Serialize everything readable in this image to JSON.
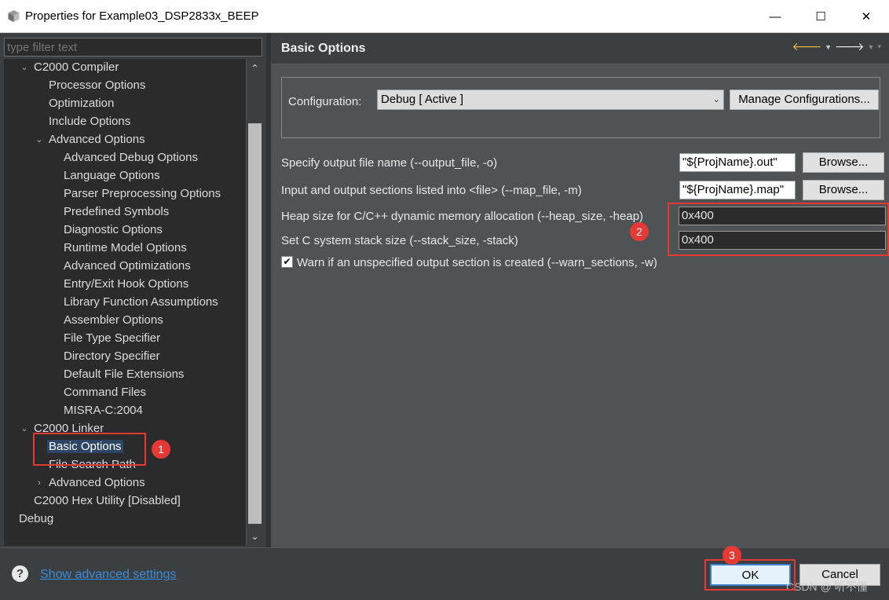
{
  "window": {
    "title": "Properties for Example03_DSP2833x_BEEP",
    "minimize_glyph": "—",
    "maximize_glyph": "☐",
    "close_glyph": "✕"
  },
  "left": {
    "filter_placeholder": "type filter text",
    "tree": [
      {
        "label": "C2000 Compiler",
        "indent": 1,
        "twisty": "⌄"
      },
      {
        "label": "Processor Options",
        "indent": 2
      },
      {
        "label": "Optimization",
        "indent": 2
      },
      {
        "label": "Include Options",
        "indent": 2
      },
      {
        "label": "Advanced Options",
        "indent": 2,
        "twisty": "⌄"
      },
      {
        "label": "Advanced Debug Options",
        "indent": 3
      },
      {
        "label": "Language Options",
        "indent": 3
      },
      {
        "label": "Parser Preprocessing Options",
        "indent": 3
      },
      {
        "label": "Predefined Symbols",
        "indent": 3
      },
      {
        "label": "Diagnostic Options",
        "indent": 3
      },
      {
        "label": "Runtime Model Options",
        "indent": 3
      },
      {
        "label": "Advanced Optimizations",
        "indent": 3
      },
      {
        "label": "Entry/Exit Hook Options",
        "indent": 3
      },
      {
        "label": "Library Function Assumptions",
        "indent": 3
      },
      {
        "label": "Assembler Options",
        "indent": 3
      },
      {
        "label": "File Type Specifier",
        "indent": 3
      },
      {
        "label": "Directory Specifier",
        "indent": 3
      },
      {
        "label": "Default File Extensions",
        "indent": 3
      },
      {
        "label": "Command Files",
        "indent": 3
      },
      {
        "label": "MISRA-C:2004",
        "indent": 3
      },
      {
        "label": "C2000 Linker",
        "indent": 1,
        "twisty": "⌄"
      },
      {
        "label": "Basic Options",
        "indent": 2,
        "selected": true
      },
      {
        "label": "File Search Path",
        "indent": 2
      },
      {
        "label": "Advanced Options",
        "indent": 2,
        "twisty": "›"
      },
      {
        "label": "C2000 Hex Utility  [Disabled]",
        "indent": 1
      },
      {
        "label": "Debug",
        "indent": 0
      }
    ]
  },
  "right": {
    "page_title": "Basic Options",
    "config_label": "Configuration:",
    "config_value": "Debug  [ Active ]",
    "manage_label": "Manage Configurations...",
    "options": {
      "output_file_label": "Specify output file name (--output_file, -o)",
      "output_file_value": "\"${ProjName}.out\"",
      "map_file_label": "Input and output sections listed into <file> (--map_file, -m)",
      "map_file_value": "\"${ProjName}.map\"",
      "browse_label": "Browse...",
      "heap_label": "Heap size for C/C++ dynamic memory allocation (--heap_size, -heap)",
      "heap_value": "0x400",
      "stack_label": "Set C system stack size (--stack_size, -stack)",
      "stack_value": "0x400",
      "warn_label": "Warn if an unspecified output section is created (--warn_sections, -w)",
      "warn_checked": true
    }
  },
  "footer": {
    "help_glyph": "?",
    "advanced_link": "Show advanced settings",
    "ok_label": "OK",
    "cancel_label": "Cancel",
    "watermark": "CSDN @ 听不懂"
  },
  "annotations": [
    "1",
    "2",
    "3"
  ]
}
